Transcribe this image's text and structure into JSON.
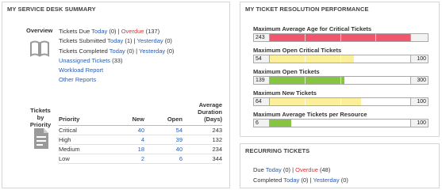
{
  "summary": {
    "title": "MY SERVICE DESK SUMMARY",
    "overview_label": "Overview",
    "due": {
      "label": "Tickets Due",
      "today": "Today",
      "today_count": "(0)",
      "sep": "|",
      "overdue": "Overdue",
      "overdue_count": "(137)"
    },
    "submitted": {
      "label": "Tickets Submitted",
      "today": "Today",
      "today_count": "(1)",
      "sep": "|",
      "yesterday": "Yesterday",
      "yesterday_count": "(0)"
    },
    "completed": {
      "label": "Tickets Completed",
      "today": "Today",
      "today_count": "(0)",
      "sep": "|",
      "yesterday": "Yesterday",
      "yesterday_count": "(0)"
    },
    "unassigned": {
      "label": "Unassigned Tickets",
      "count": "(33)"
    },
    "workload_report": "Workload Report",
    "other_reports": "Other Reports",
    "priority_label_1": "Tickets by",
    "priority_label_2": "Priority",
    "table": {
      "headers": {
        "priority": "Priority",
        "new": "New",
        "open": "Open",
        "duration_1": "Average",
        "duration_2": "Duration",
        "duration_3": "(Days)"
      },
      "rows": [
        {
          "priority": "Critical",
          "new": "40",
          "open": "54",
          "duration": "243"
        },
        {
          "priority": "High",
          "new": "4",
          "open": "39",
          "duration": "132"
        },
        {
          "priority": "Medium",
          "new": "18",
          "open": "40",
          "duration": "234"
        },
        {
          "priority": "Low",
          "new": "2",
          "open": "6",
          "duration": "344"
        }
      ]
    }
  },
  "performance": {
    "title": "MY TICKET RESOLUTION PERFORMANCE",
    "metrics": [
      {
        "label": "Maximum Average Age for Critical Tickets",
        "low": "243",
        "high": "",
        "fill": 1.0,
        "color": "#f0566e"
      },
      {
        "label": "Maximum Open Critical Tickets",
        "low": "54",
        "high": "100",
        "fill": 0.6,
        "color": "#fbef9a"
      },
      {
        "label": "Maximum Open Tickets",
        "low": "139",
        "high": "300",
        "fill": 0.53,
        "color": "#86c441"
      },
      {
        "label": "Maximum New Tickets",
        "low": "64",
        "high": "100",
        "fill": 0.65,
        "color": "#fbef9a"
      },
      {
        "label": "Maximum Average Tickets per Resource",
        "low": "6",
        "high": "100",
        "fill": 0.15,
        "color": "#86c441"
      }
    ]
  },
  "recurring": {
    "title": "RECURRING TICKETS",
    "due": {
      "label": "Due",
      "today": "Today",
      "today_count": "(0)",
      "sep": "|",
      "overdue": "Overdue",
      "overdue_count": "(48)"
    },
    "completed": {
      "label": "Completed",
      "today": "Today",
      "today_count": "(0)",
      "sep": "|",
      "yesterday": "Yesterday",
      "yesterday_count": "(0)"
    }
  },
  "colors": {
    "link": "#2a5db0",
    "overdue": "#e03030",
    "red": "#f0566e",
    "yellow": "#fbef9a",
    "green": "#86c441"
  }
}
